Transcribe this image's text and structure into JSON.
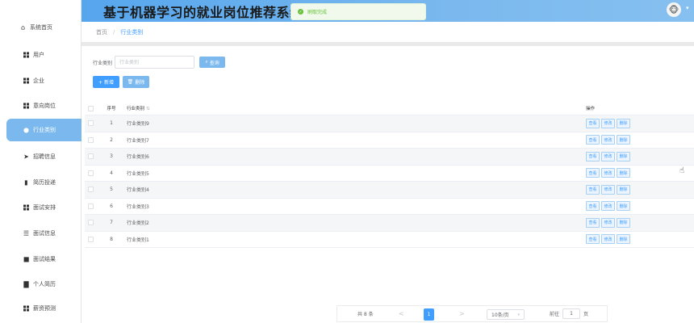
{
  "header": {
    "title": "基于机器学习的就业岗位推荐系统",
    "avatar_icon": "avatar-icon"
  },
  "toast": {
    "message": "刷取完成"
  },
  "sidebar": {
    "items": [
      {
        "label": "系统首页",
        "icon": "home-icon"
      },
      {
        "label": "用户",
        "icon": "grid-icon"
      },
      {
        "label": "企业",
        "icon": "grid-icon"
      },
      {
        "label": "意向岗位",
        "icon": "grid-icon"
      },
      {
        "label": "行业类别",
        "icon": "bulb-icon",
        "active": true
      },
      {
        "label": "招聘信息",
        "icon": "send-icon"
      },
      {
        "label": "简历投递",
        "icon": "bar-chart-icon"
      },
      {
        "label": "面试安排",
        "icon": "grid-icon"
      },
      {
        "label": "面试信息",
        "icon": "filter-icon"
      },
      {
        "label": "面试结果",
        "icon": "square-icon"
      },
      {
        "label": "个人简历",
        "icon": "doc-icon"
      },
      {
        "label": "薪资预测",
        "icon": "grid-icon"
      }
    ]
  },
  "breadcrumb": {
    "home": "首页",
    "separator": "/",
    "current": "行业类别"
  },
  "search": {
    "label": "行业类别",
    "placeholder": "行业类别",
    "button": "查询"
  },
  "actions": {
    "add": "+ 新增",
    "delete": "删除"
  },
  "table": {
    "headers": {
      "no": "序号",
      "name": "行业类别",
      "ops": "操作"
    },
    "rows": [
      {
        "no": "1",
        "name": "行业类别9"
      },
      {
        "no": "2",
        "name": "行业类别7"
      },
      {
        "no": "3",
        "name": "行业类别6"
      },
      {
        "no": "4",
        "name": "行业类别5"
      },
      {
        "no": "5",
        "name": "行业类别4"
      },
      {
        "no": "6",
        "name": "行业类别3"
      },
      {
        "no": "7",
        "name": "行业类别2"
      },
      {
        "no": "8",
        "name": "行业类别1"
      }
    ],
    "op_labels": {
      "view": "查看",
      "edit": "修改",
      "delete": "删除"
    }
  },
  "pagination": {
    "total": "共 8 条",
    "prev": "<",
    "current": "1",
    "next": ">",
    "page_size": "10条/页",
    "goto_prefix": "前往",
    "goto_value": "1",
    "goto_suffix": "页"
  },
  "colors": {
    "accent": "#409eff",
    "header": "#7ab8ee",
    "sidebar_active": "#7ab8ee",
    "success": "#67c23a"
  }
}
